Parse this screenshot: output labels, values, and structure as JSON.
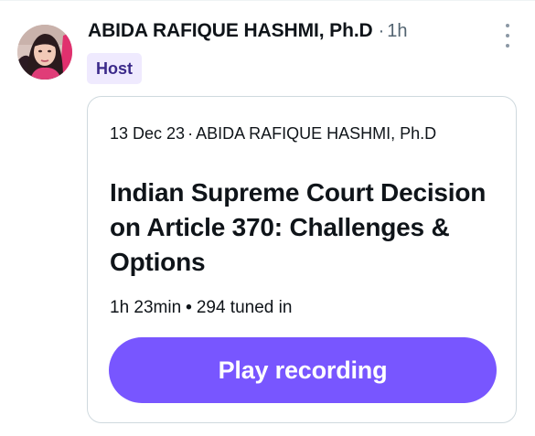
{
  "post": {
    "author_name": "ABIDA RAFIQUE HASHMI, Ph.D",
    "separator": "·",
    "time_ago": "1h",
    "role_badge": "Host",
    "more_icon": "more-vertical-icon",
    "avatar_icon": "profile-photo"
  },
  "space_card": {
    "date": "13 Dec 23",
    "separator": "·",
    "host_name": "ABIDA RAFIQUE HASHMI, Ph.D",
    "title": "Indian Supreme Court Decision on Article 370: Challenges & Options",
    "duration": "1h 23min",
    "bullet": "•",
    "listeners": "294 tuned in",
    "play_label": "Play recording"
  },
  "colors": {
    "accent": "#7856ff",
    "badge_bg": "#efeafe",
    "badge_text": "#3b2a8a",
    "muted_text": "#536471",
    "card_border": "#cfd9de"
  }
}
